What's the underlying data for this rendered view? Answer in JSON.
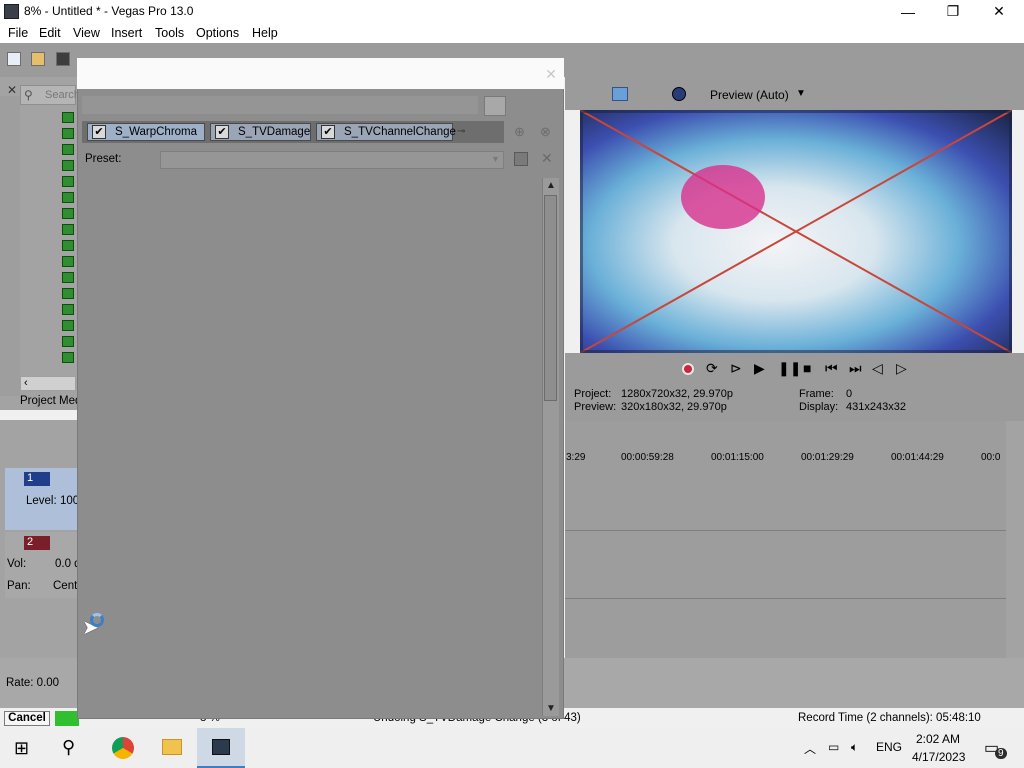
{
  "app": {
    "title": "8% - Untitled * - Vegas Pro 13.0",
    "minimize": "—",
    "maximize": "❐",
    "close": "✕"
  },
  "menu": [
    "File",
    "Edit",
    "View",
    "Insert",
    "Tools",
    "Options",
    "Help"
  ],
  "explorer": {
    "search_placeholder": "Search",
    "project_media_tab": "Project Med"
  },
  "tracks": [
    {
      "number": "1",
      "label": "Level:",
      "value": "100"
    },
    {
      "number": "2",
      "vol_label": "Vol:",
      "vol_value": "0.0 d",
      "pan_label": "Pan:",
      "pan_value": "Cent"
    }
  ],
  "rate": "Rate: 0.00",
  "preview": {
    "mode": "Preview (Auto)",
    "project_label": "Project:",
    "project_value": "1280x720x32, 29.970p",
    "preview_label": "Preview:",
    "preview_value": "320x180x32, 29.970p",
    "frame_label": "Frame:",
    "frame_value": "0",
    "display_label": "Display:",
    "display_value": "431x243x32"
  },
  "timeline": {
    "ruler": [
      "3:29",
      "00:00:59:28",
      "00:01:15:00",
      "00:01:29:29",
      "00:01:44:29",
      "00:0"
    ]
  },
  "dialog": {
    "title": "",
    "fx_tabs": [
      "S_WarpChroma",
      "S_TVDamage",
      "S_TVChannelChange"
    ],
    "preset_label": "Preset:",
    "preset_value": ""
  },
  "status": {
    "cancel": "Cancel",
    "progress_text": "8 %",
    "undo_text": "Undoing S_TVDamage Change (3 of 43)",
    "record_time": "Record Time (2 channels): 05:48:10"
  },
  "taskbar": {
    "language": "ENG",
    "time": "2:02 AM",
    "date": "4/17/2023",
    "notifications": "9"
  },
  "colors": {
    "accent_blue": "#3c7fc4",
    "track_selected": "#aebfd9",
    "progress_green": "#2fbf2f"
  }
}
